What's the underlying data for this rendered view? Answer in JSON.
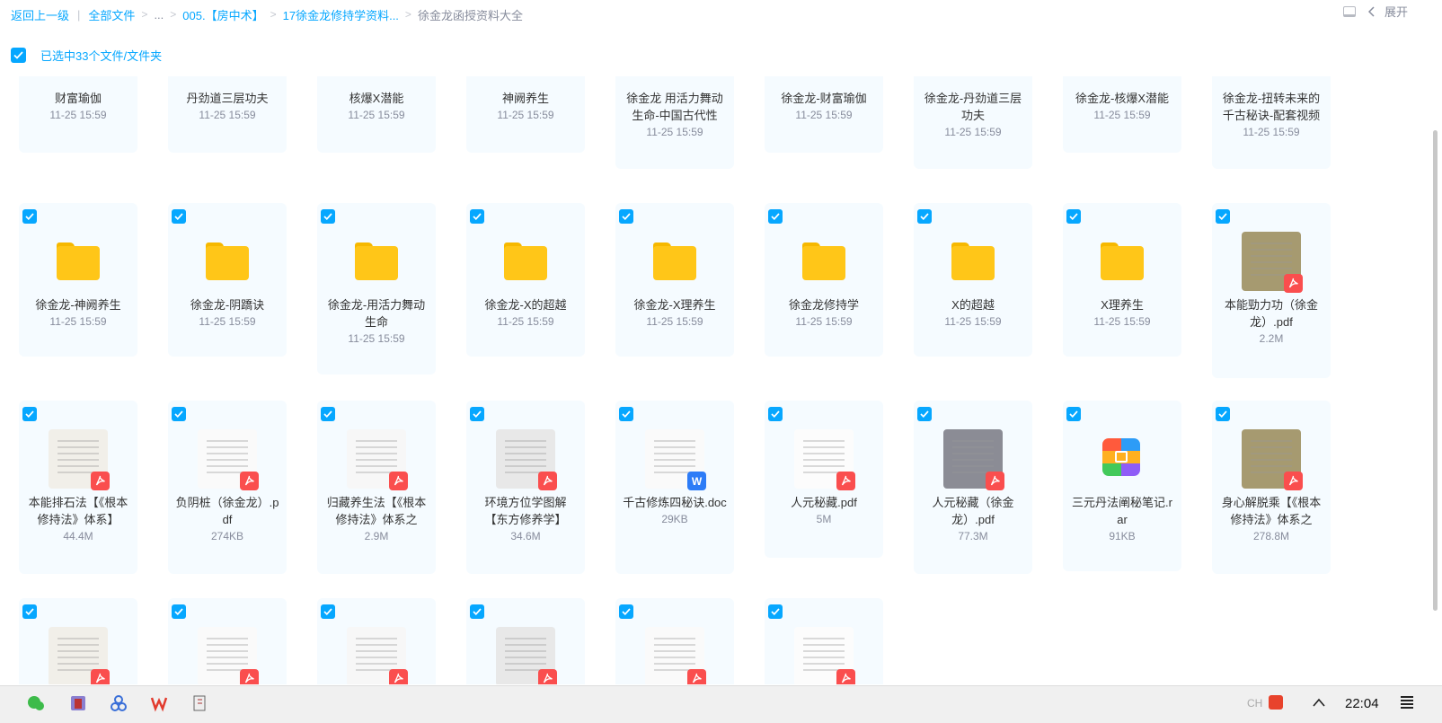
{
  "breadcrumb": {
    "back": "返回上一级",
    "root": "全部文件",
    "ellipsis": "...",
    "folder1": "005.【房中术】",
    "folder2": "17徐金龙修持学资料...",
    "current": "徐金龙函授资料大全"
  },
  "top_right": {
    "expand_label": "展开"
  },
  "selection": {
    "label": "已选中33个文件/文件夹"
  },
  "rows": [
    [
      {
        "name": "财富瑜伽",
        "meta": "11-25 15:59",
        "type": "folder"
      },
      {
        "name": "丹劲道三层功夫",
        "meta": "11-25 15:59",
        "type": "folder"
      },
      {
        "name": "核爆X潜能",
        "meta": "11-25 15:59",
        "type": "folder"
      },
      {
        "name": "神阙养生",
        "meta": "11-25 15:59",
        "type": "folder"
      },
      {
        "name": "徐金龙 用活力舞动生命-中国古代性",
        "meta": "11-25 15:59",
        "type": "folder"
      },
      {
        "name": "徐金龙-财富瑜伽",
        "meta": "11-25 15:59",
        "type": "folder"
      },
      {
        "name": "徐金龙-丹劲道三层功夫",
        "meta": "11-25 15:59",
        "type": "folder"
      },
      {
        "name": "徐金龙-核爆X潜能",
        "meta": "11-25 15:59",
        "type": "folder"
      },
      {
        "name": "徐金龙-扭转未来的千古秘诀-配套视频",
        "meta": "11-25 15:59",
        "type": "folder"
      }
    ],
    [
      {
        "name": "徐金龙-神阙养生",
        "meta": "11-25 15:59",
        "type": "folder"
      },
      {
        "name": "徐金龙-阴蹻诀",
        "meta": "11-25 15:59",
        "type": "folder"
      },
      {
        "name": "徐金龙-用活力舞动生命",
        "meta": "11-25 15:59",
        "type": "folder"
      },
      {
        "name": "徐金龙-X的超越",
        "meta": "11-25 15:59",
        "type": "folder"
      },
      {
        "name": "徐金龙-X理养生",
        "meta": "11-25 15:59",
        "type": "folder"
      },
      {
        "name": "徐金龙修持学",
        "meta": "11-25 15:59",
        "type": "folder"
      },
      {
        "name": "X的超越",
        "meta": "11-25 15:59",
        "type": "folder"
      },
      {
        "name": "X理养生",
        "meta": "11-25 15:59",
        "type": "folder"
      },
      {
        "name": "本能勁力功（徐金龙）.pdf",
        "meta": "2.2M",
        "type": "pdf"
      }
    ],
    [
      {
        "name": "本能排石法【《根本修持法》体系】",
        "meta": "44.4M",
        "type": "pdf"
      },
      {
        "name": "负阴桩（徐金龙）.pdf",
        "meta": "274KB",
        "type": "pdf"
      },
      {
        "name": "归藏养生法【《根本修持法》体系之",
        "meta": "2.9M",
        "type": "pdf"
      },
      {
        "name": "环境方位学图解【东方修养学】",
        "meta": "34.6M",
        "type": "pdf"
      },
      {
        "name": "千古修炼四秘诀.doc",
        "meta": "29KB",
        "type": "word"
      },
      {
        "name": "人元秘藏.pdf",
        "meta": "5M",
        "type": "pdf"
      },
      {
        "name": "人元秘藏（徐金龙）.pdf",
        "meta": "77.3M",
        "type": "pdf"
      },
      {
        "name": "三元丹法阐秘笔记.rar",
        "meta": "91KB",
        "type": "rar"
      },
      {
        "name": "身心解脱乘【《根本修持法》体系之",
        "meta": "278.8M",
        "type": "pdf"
      }
    ],
    [
      {
        "name": "",
        "meta": "",
        "type": "pdf"
      },
      {
        "name": "",
        "meta": "",
        "type": "pdf"
      },
      {
        "name": "",
        "meta": "",
        "type": "pdf"
      },
      {
        "name": "",
        "meta": "",
        "type": "pdf"
      },
      {
        "name": "",
        "meta": "",
        "type": "pdf"
      },
      {
        "name": "",
        "meta": "",
        "type": "pdf"
      }
    ]
  ],
  "taskbar": {
    "time": "22:04",
    "ime": "CH"
  },
  "colors": {
    "accent": "#06a7ff",
    "card_bg": "#f5fbff",
    "folder": "#ffc618",
    "pdf": "#fa4e4e",
    "word": "#2d7cf7"
  }
}
